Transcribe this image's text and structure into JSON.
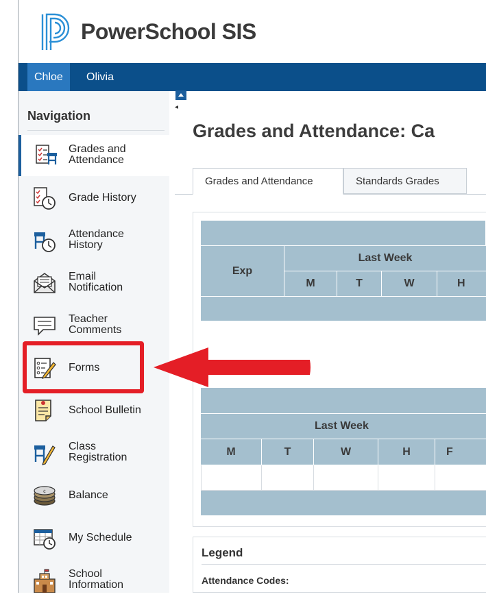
{
  "app": {
    "title": "PowerSchool SIS",
    "brand_color": "#0b4f8a",
    "logo_icon": "powerschool-logo-icon"
  },
  "students": [
    {
      "name": "Chloe",
      "active": true
    },
    {
      "name": "Olivia",
      "active": false
    }
  ],
  "sidebar": {
    "title": "Navigation",
    "items": [
      {
        "label": "Grades and Attendance",
        "icon": "grades-attendance-icon",
        "active": true
      },
      {
        "label": "Grade History",
        "icon": "grade-history-icon"
      },
      {
        "label": "Attendance History",
        "icon": "attendance-history-icon"
      },
      {
        "label": "Email Notification",
        "icon": "email-notification-icon"
      },
      {
        "label": "Teacher Comments",
        "icon": "teacher-comments-icon"
      },
      {
        "label": "Forms",
        "icon": "forms-icon"
      },
      {
        "label": "School Bulletin",
        "icon": "school-bulletin-icon"
      },
      {
        "label": "Class Registration",
        "icon": "class-registration-icon"
      },
      {
        "label": "Balance",
        "icon": "balance-icon"
      },
      {
        "label": "My Schedule",
        "icon": "my-schedule-icon"
      },
      {
        "label": "School Information",
        "icon": "school-information-icon"
      }
    ]
  },
  "main": {
    "page_title": "Grades and Attendance: Ca",
    "tabs": [
      {
        "label": "Grades and Attendance",
        "active": true
      },
      {
        "label": "Standards Grades",
        "active": false
      }
    ],
    "table1": {
      "exp_header": "Exp",
      "group_header": "Last Week",
      "days": [
        "M",
        "T",
        "W",
        "H"
      ]
    },
    "table2": {
      "group_header": "Last Week",
      "days": [
        "M",
        "T",
        "W",
        "H",
        "F"
      ]
    },
    "legend": {
      "title": "Legend",
      "attendance_codes_label": "Attendance Codes:"
    }
  },
  "annotation": {
    "highlight_color": "#e41e26",
    "target": "Forms"
  }
}
